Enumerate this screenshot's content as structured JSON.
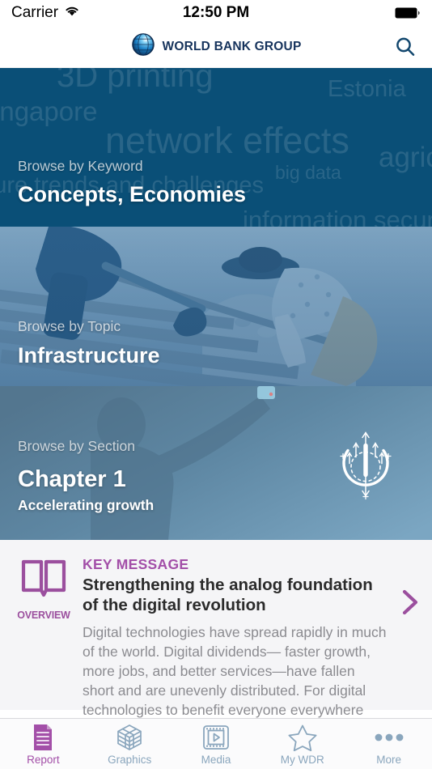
{
  "status_bar": {
    "carrier": "Carrier",
    "wifi_icon": "wifi-icon",
    "time": "12:50 PM",
    "battery_icon": "battery-full-icon"
  },
  "nav_bar": {
    "logo_icon": "world-bank-globe-icon",
    "brand": "WORLD BANK GROUP",
    "search_icon": "search-icon"
  },
  "panels": [
    {
      "label": "Browse by Keyword",
      "title": "Concepts, Economies",
      "background_color": "#0a4f77",
      "keywords": [
        "3D printing",
        "Estonia",
        "Singapore",
        "network effects",
        "agriculture",
        "big data",
        "future trends and challenges",
        "information security"
      ]
    },
    {
      "label": "Browse by Topic",
      "title": "Infrastructure",
      "background_color": "#3c6b94"
    },
    {
      "label": "Browse by Section",
      "title": "Chapter 1",
      "subtitle": "Accelerating growth",
      "background_color": "#5b7f99",
      "icon": "accelerating-growth-power-icon"
    }
  ],
  "key_message": {
    "icon": "open-book-icon",
    "icon_label": "OVERVIEW",
    "kicker": "KEY MESSAGE",
    "title": "Strengthening the analog foundation of the digital revolution",
    "body": "Digital technologies have spread rapidly in much of the world. Digital dividends— faster growth, more jobs, and better services—have fallen short and are unevenly distributed. For digital technologies to benefit everyone everywhere requires closing the remaining digital divide.",
    "chevron_icon": "chevron-right-icon",
    "accent_color": "#a34fa8"
  },
  "tab_bar": {
    "active_color": "#a34fa8",
    "inactive_color": "#8aa6bd",
    "items": [
      {
        "label": "Report",
        "icon": "document-icon",
        "active": true
      },
      {
        "label": "Graphics",
        "icon": "cube-icon",
        "active": false
      },
      {
        "label": "Media",
        "icon": "film-play-icon",
        "active": false
      },
      {
        "label": "My WDR",
        "icon": "star-icon",
        "active": false
      },
      {
        "label": "More",
        "icon": "ellipsis-icon",
        "active": false
      }
    ]
  }
}
